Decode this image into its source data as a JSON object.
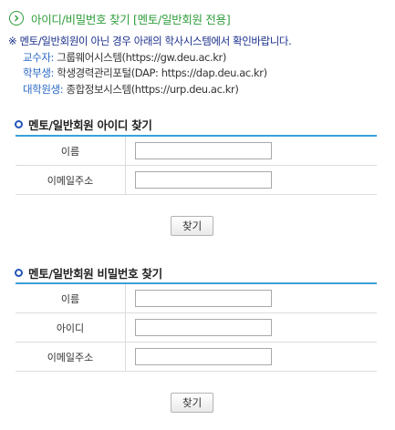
{
  "header": {
    "title": "아이디/비밀번호 찾기 [멘토/일반회원 전용]"
  },
  "notice": {
    "main": "※ 멘토/일반회원이 아닌 경우 아래의 학사시스템에서 확인바랍니다.",
    "systems": [
      {
        "role": "교수자:",
        "system": " 그룹웨어시스템(https://gw.deu.ac.kr)"
      },
      {
        "role": "학부생:",
        "system": " 학생경력관리포털(DAP: https://dap.deu.ac.kr)"
      },
      {
        "role": "대학원생:",
        "system": " 종합정보시스템(https://urp.deu.ac.kr)"
      }
    ]
  },
  "find_id": {
    "title": "멘토/일반회원 아이디 찾기",
    "name_label": "이름",
    "email_label": "이메일주소",
    "name_value": "",
    "email_value": "",
    "button": "찾기"
  },
  "find_pw": {
    "title": "멘토/일반회원 비밀번호 찾기",
    "name_label": "이름",
    "id_label": "아이디",
    "email_label": "이메일주소",
    "name_value": "",
    "id_value": "",
    "email_value": "",
    "button": "찾기"
  },
  "colors": {
    "accent_green": "#2e9c3a",
    "notice_navy": "#1a2f8a",
    "role_blue": "#2a68c5",
    "table_border": "#3aa0d9"
  }
}
